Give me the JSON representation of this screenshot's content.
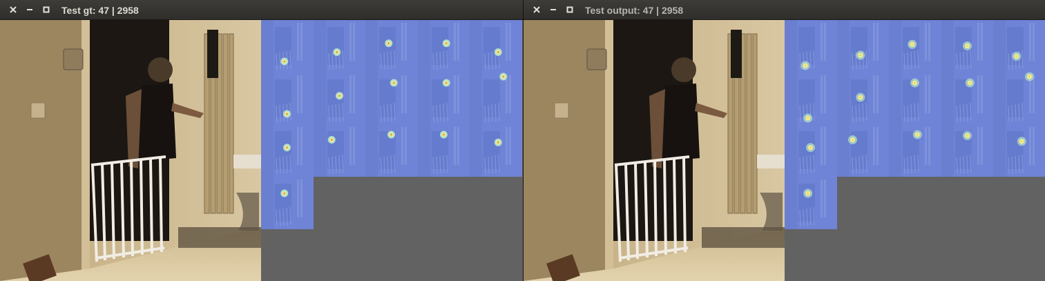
{
  "windows": [
    {
      "id": "gt",
      "title": "Test gt: 47 | 2958"
    },
    {
      "id": "out",
      "title": "Test output: 47 | 2958"
    }
  ],
  "heatmap_grid": {
    "columns": 5,
    "count": 16
  },
  "colors": {
    "titlebar": "#33322f",
    "title_text": "#dfdbd2",
    "background_gray": "#626262",
    "heatmap_blue": "#6f84d6",
    "peak_yellow": "#f4f08a"
  },
  "icons": [
    "close-icon",
    "minimize-icon",
    "maximize-icon"
  ]
}
